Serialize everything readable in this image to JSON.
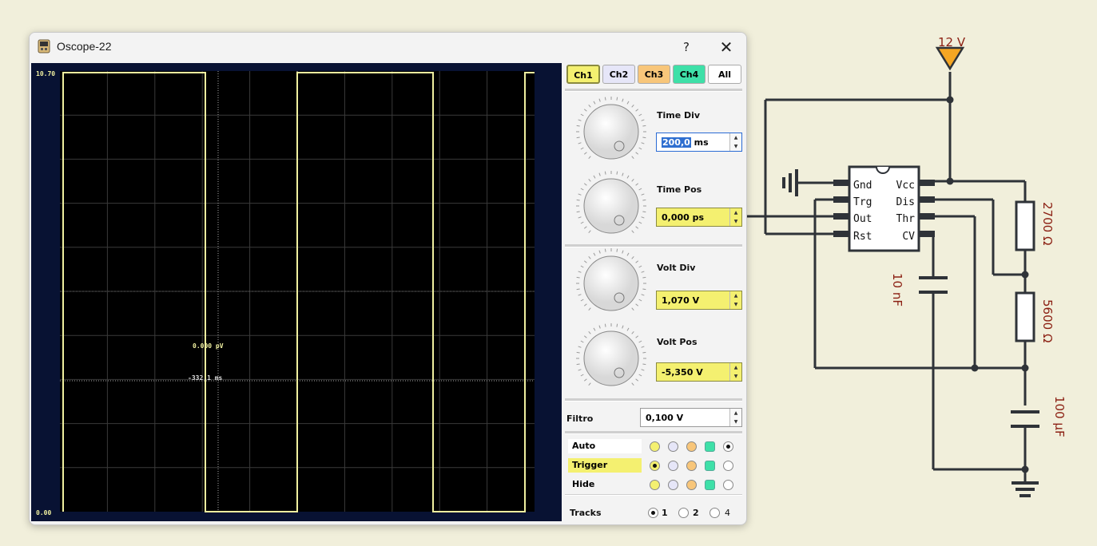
{
  "window": {
    "title": "Oscope-22",
    "help_label": "?",
    "close_label": "✕"
  },
  "screen": {
    "y_max_label": "10.70",
    "y_min_label": "0.00",
    "cursor_voltage": "0.000 pV",
    "cursor_time": "-332.1 ms",
    "trace_color": "#f0f0a0",
    "background_color": "#000000"
  },
  "channels": {
    "tabs": [
      {
        "label": "Ch1",
        "color": "#f4f070"
      },
      {
        "label": "Ch2",
        "color": "#e6e6f8"
      },
      {
        "label": "Ch3",
        "color": "#f8c67a"
      },
      {
        "label": "Ch4",
        "color": "#3ee0a8"
      },
      {
        "label": "All",
        "color": "#ffffff"
      }
    ],
    "selected": "Ch1"
  },
  "controls": {
    "time_div": {
      "label": "Time Div",
      "value_selected": "200,0",
      "unit": " ms"
    },
    "time_pos": {
      "label": "Time Pos",
      "value": "0,000 ps"
    },
    "volt_div": {
      "label": "Volt Div",
      "value": "1,070 V"
    },
    "volt_pos": {
      "label": "Volt Pos",
      "value": "-5,350 V"
    },
    "filtro": {
      "label": "Filtro",
      "value": "0,100 V"
    }
  },
  "modes": {
    "rows": [
      {
        "label": "Auto",
        "selected_channel": "All"
      },
      {
        "label": "Trigger",
        "selected_channel": "Ch1"
      },
      {
        "label": "Hide",
        "selected_channel": "none"
      }
    ]
  },
  "tracks": {
    "label": "Tracks",
    "options": [
      "1",
      "2",
      "4"
    ],
    "selected": "1"
  },
  "circuit": {
    "supply_label": "12 V",
    "ic_pins_left": [
      "Gnd",
      "Trg",
      "Out",
      "Rst"
    ],
    "ic_pins_right": [
      "Vcc",
      "Dis",
      "Thr",
      "CV"
    ],
    "r1_label": "2700 Ω",
    "r2_label": "5600 Ω",
    "c1_label": "10 nF",
    "c2_label": "100 µF",
    "supply_color": "#f5a623"
  }
}
